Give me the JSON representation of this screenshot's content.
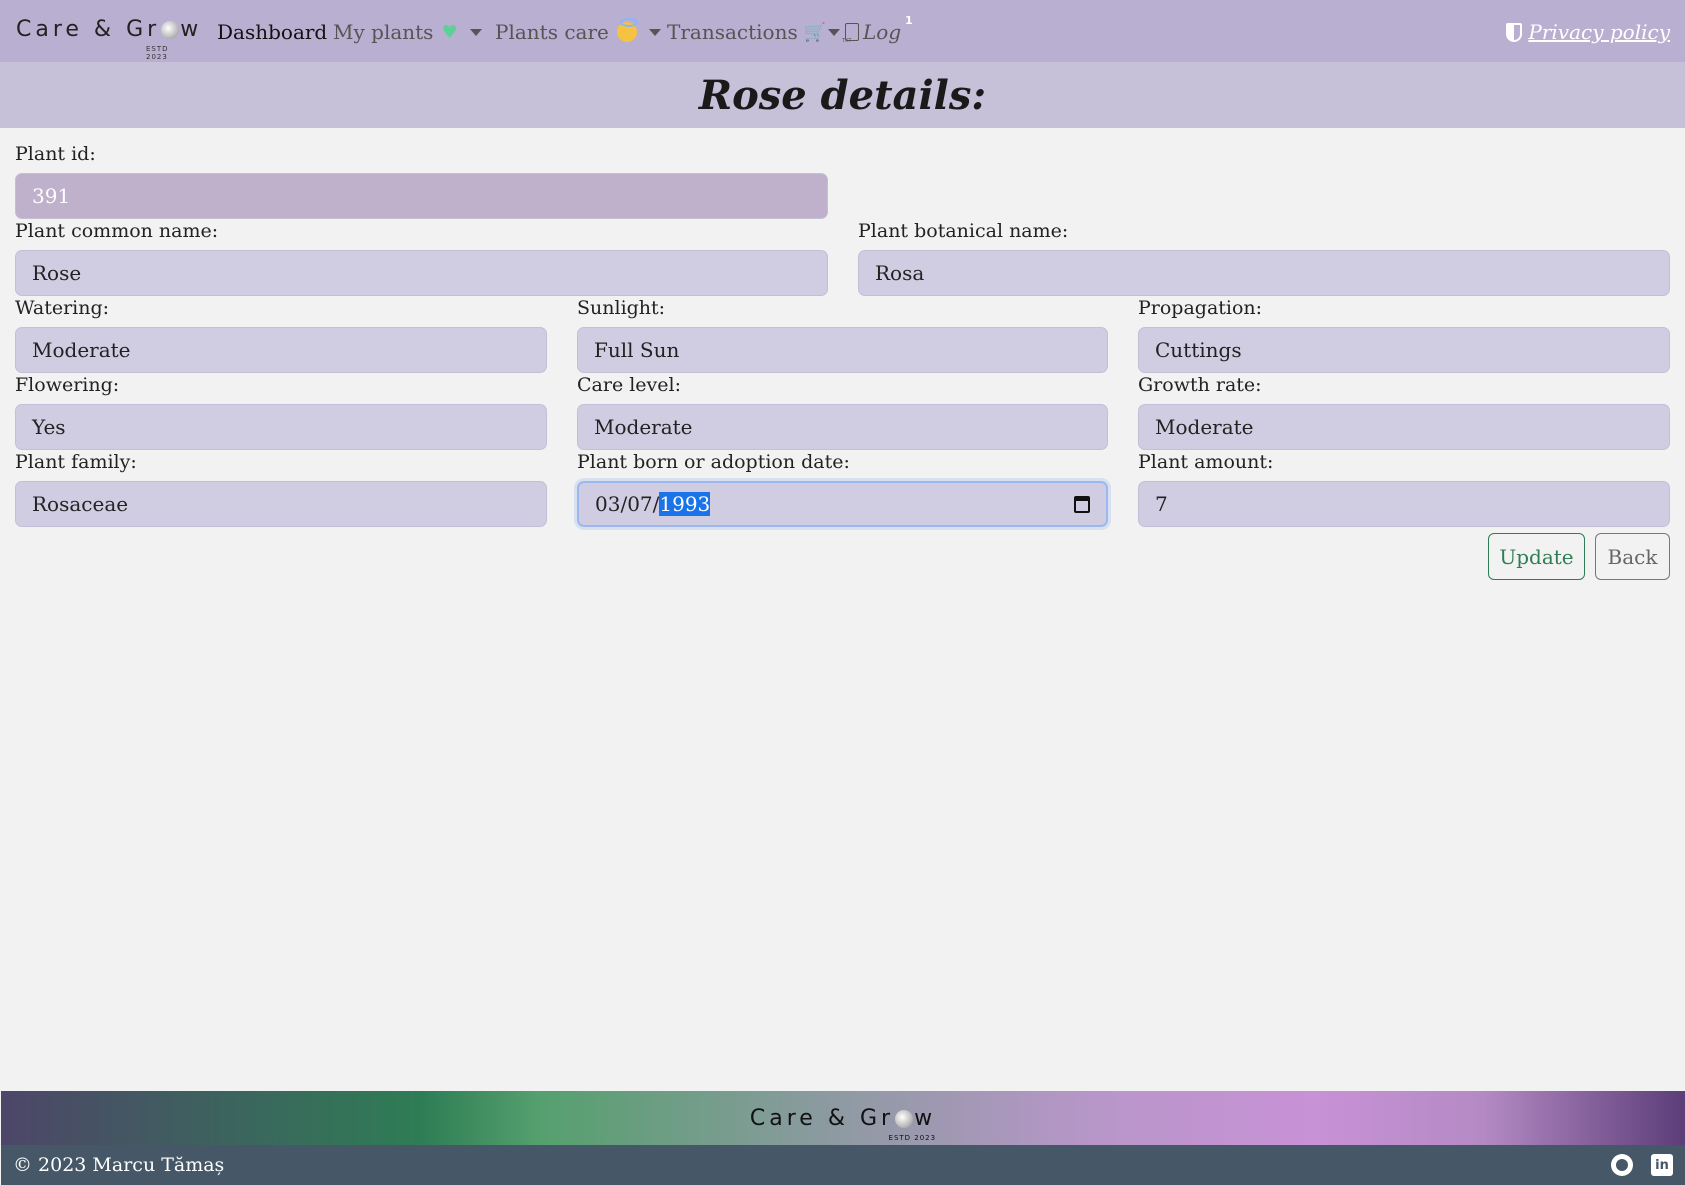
{
  "navbar": {
    "brand": "Care & Gr",
    "brand_end": "w",
    "brand_estd": "ESTD 2023",
    "items": [
      {
        "label": "Dashboard"
      },
      {
        "label": "My plants"
      },
      {
        "label": "Plants care"
      },
      {
        "label": "Transactions"
      },
      {
        "label": "Log"
      }
    ],
    "log_badge": "1",
    "privacy": "Privacy policy"
  },
  "page": {
    "title": "Rose details:"
  },
  "form": {
    "plant_id": {
      "label": "Plant id:",
      "value": "391"
    },
    "common_name": {
      "label": "Plant common name:",
      "value": "Rose"
    },
    "botanical_name": {
      "label": "Plant botanical name:",
      "value": "Rosa"
    },
    "watering": {
      "label": "Watering:",
      "value": "Moderate"
    },
    "sunlight": {
      "label": "Sunlight:",
      "value": "Full Sun"
    },
    "propagation": {
      "label": "Propagation:",
      "value": "Cuttings"
    },
    "flowering": {
      "label": "Flowering:",
      "value": "Yes"
    },
    "care_level": {
      "label": "Care level:",
      "value": "Moderate"
    },
    "growth_rate": {
      "label": "Growth rate:",
      "value": "Moderate"
    },
    "family": {
      "label": "Plant family:",
      "value": "Rosaceae"
    },
    "date": {
      "label": "Plant born or adoption date:",
      "value_prefix": "03/07/",
      "value_selected": "1993"
    },
    "amount": {
      "label": "Plant amount:",
      "value": "7"
    }
  },
  "buttons": {
    "update": "Update",
    "back": "Back"
  },
  "footer": {
    "brand": "Care & Gr",
    "brand_end": "w",
    "brand_estd": "ESTD 2023",
    "copyright": "© 2023 Marcu Tămaș"
  },
  "colors": {
    "navbar": "#b9afd1",
    "title_bar": "#c6c0d8",
    "input_bg": "#d0cde2",
    "update_accent": "#2e7d55",
    "footer_bottom": "#465868"
  }
}
